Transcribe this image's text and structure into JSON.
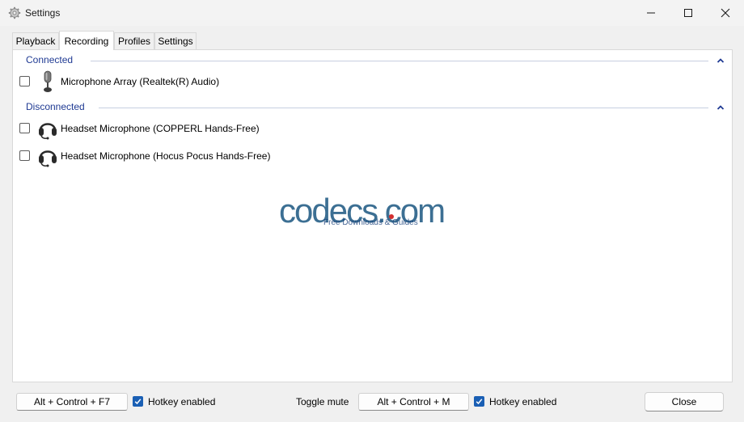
{
  "window": {
    "title": "Settings",
    "icon": "gear-icon"
  },
  "tabs": [
    {
      "label": "Playback",
      "active": false
    },
    {
      "label": "Recording",
      "active": true
    },
    {
      "label": "Profiles",
      "active": false
    },
    {
      "label": "Settings",
      "active": false
    }
  ],
  "groups": {
    "connected": {
      "label": "Connected",
      "devices": [
        {
          "label": "Microphone Array (Realtek(R) Audio)",
          "icon": "microphone-icon",
          "checked": false
        }
      ]
    },
    "disconnected": {
      "label": "Disconnected",
      "devices": [
        {
          "label": "Headset Microphone (COPPERL Hands-Free)",
          "icon": "headset-icon",
          "checked": false
        },
        {
          "label": "Headset Microphone (Hocus Pocus Hands-Free)",
          "icon": "headset-icon",
          "checked": false
        }
      ]
    }
  },
  "watermark": {
    "main": "codecs.com",
    "sub": "Free Downloads & Guides"
  },
  "footer": {
    "hotkey1": "Alt + Control + F7",
    "hotkey1_enabled_label": "Hotkey enabled",
    "toggle_mute_label": "Toggle mute",
    "hotkey2": "Alt + Control + M",
    "hotkey2_enabled_label": "Hotkey enabled",
    "close_label": "Close"
  },
  "colors": {
    "accent": "#1a5fb4",
    "group_label": "#1f3a93"
  }
}
